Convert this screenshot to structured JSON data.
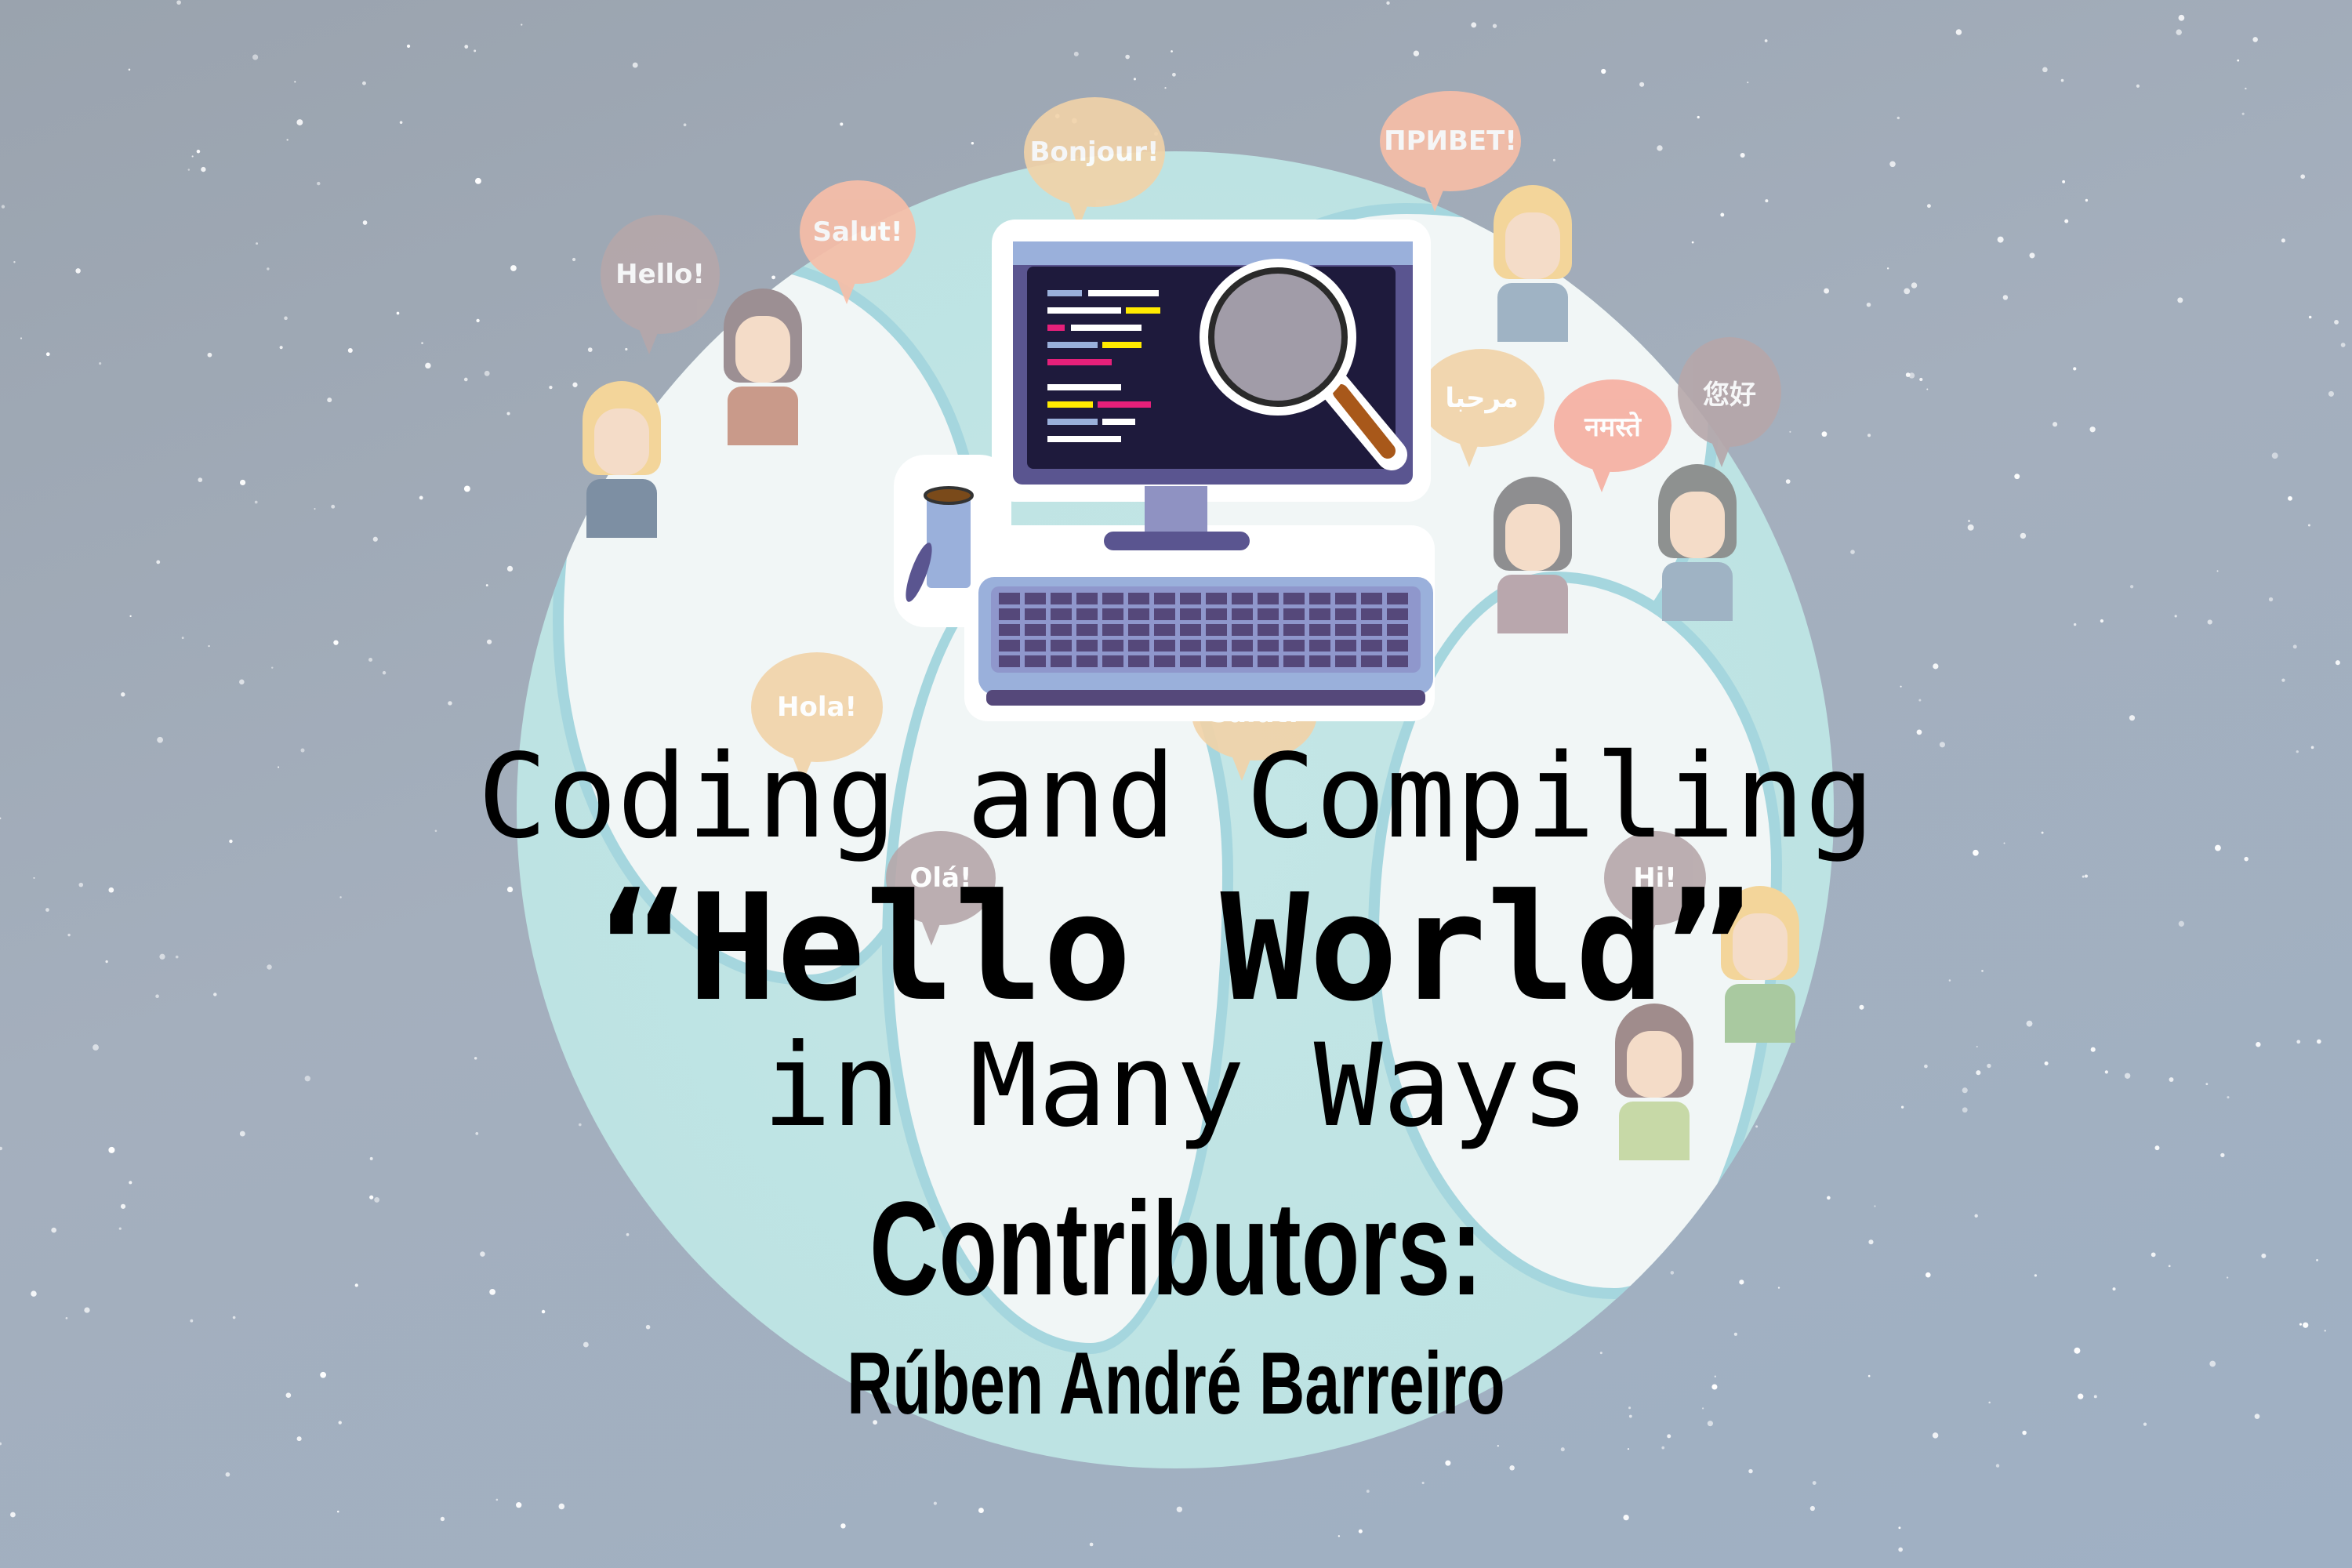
{
  "title": {
    "line1": "Coding and Compiling",
    "line2": "“Hello World”",
    "line3": "in Many Ways",
    "contributors_label": "Contributors:",
    "contributor": "Rúben André Barreiro"
  },
  "bubbles": [
    {
      "text": "Hello!",
      "color": "#b6a7aa"
    },
    {
      "text": "Salut!",
      "color": "#f8bea7"
    },
    {
      "text": "Bonjour!",
      "color": "#f2d3a8"
    },
    {
      "text": "ПРИВЕТ!",
      "color": "#f8bea7"
    },
    {
      "text": "مرحبا",
      "color": "#f2d3a8"
    },
    {
      "text": "नमस्ते",
      "color": "#f6aea0"
    },
    {
      "text": "您好",
      "color": "#b6a7aa"
    },
    {
      "text": "Hola!",
      "color": "#f2d3a8"
    },
    {
      "text": "Olá!",
      "color": "#b6a7aa"
    },
    {
      "text": "Hi!",
      "color": "#b6a7aa"
    },
    {
      "text": "Salut!",
      "color": "#f2d3a8"
    }
  ],
  "colors": {
    "background": "#9fa9b6",
    "globe": "#bde3e3",
    "land": "#f1f6f6",
    "monitor": "#5a5590",
    "screen": "#1e1a3c",
    "keyboard": "#8f97cc"
  }
}
